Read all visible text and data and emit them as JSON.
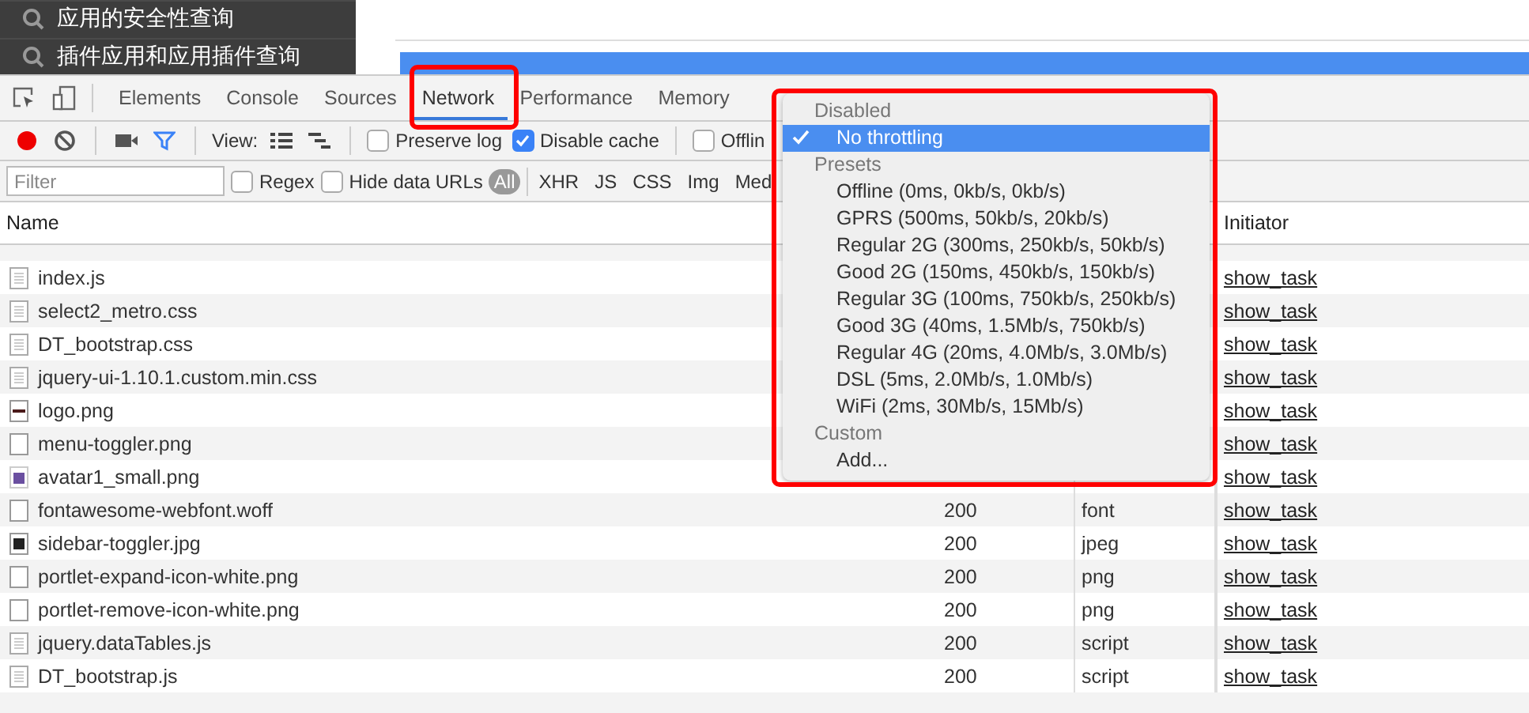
{
  "sidebar": {
    "items": [
      {
        "label": "应用的安全性查询"
      },
      {
        "label": "插件应用和应用插件查询"
      }
    ]
  },
  "devtools": {
    "tabs": [
      {
        "label": "Elements",
        "selected": false
      },
      {
        "label": "Console",
        "selected": false
      },
      {
        "label": "Sources",
        "selected": false
      },
      {
        "label": "Network",
        "selected": true
      },
      {
        "label": "Performance",
        "selected": false
      },
      {
        "label": "Memory",
        "selected": false
      }
    ],
    "toolbar": {
      "recording": true,
      "view_label": "View:",
      "options": [
        {
          "label": "Preserve log",
          "checked": false
        },
        {
          "label": "Disable cache",
          "checked": true
        },
        {
          "label": "Offlin",
          "checked": false
        }
      ]
    },
    "filter": {
      "placeholder": "Filter",
      "options": [
        {
          "label": "Regex",
          "checked": false
        },
        {
          "label": "Hide data URLs",
          "checked": false
        }
      ],
      "types": [
        {
          "label": "All",
          "selected": true
        },
        {
          "label": "XHR",
          "selected": false
        },
        {
          "label": "JS",
          "selected": false
        },
        {
          "label": "CSS",
          "selected": false
        },
        {
          "label": "Img",
          "selected": false
        },
        {
          "label": "Med",
          "selected": false
        }
      ]
    },
    "table": {
      "columns": [
        "Name",
        "Initiator"
      ],
      "rows": [
        {
          "name": "index.js",
          "kind": "doc",
          "initiator": "show_task"
        },
        {
          "name": "select2_metro.css",
          "kind": "doc",
          "initiator": "show_task"
        },
        {
          "name": "DT_bootstrap.css",
          "kind": "doc",
          "initiator": "show_task"
        },
        {
          "name": "jquery-ui-1.10.1.custom.min.css",
          "kind": "doc",
          "initiator": "show_task"
        },
        {
          "name": "logo.png",
          "kind": "logo",
          "initiator": "show_task"
        },
        {
          "name": "menu-toggler.png",
          "kind": "blank",
          "initiator": "show_task"
        },
        {
          "name": "avatar1_small.png",
          "kind": "avatar",
          "initiator": "show_task"
        },
        {
          "name": "fontawesome-webfont.woff",
          "kind": "blank",
          "status": "200",
          "type": "font",
          "initiator": "show_task"
        },
        {
          "name": "sidebar-toggler.jpg",
          "kind": "dark",
          "status": "200",
          "type": "jpeg",
          "initiator": "show_task"
        },
        {
          "name": "portlet-expand-icon-white.png",
          "kind": "blank",
          "status": "200",
          "type": "png",
          "initiator": "show_task"
        },
        {
          "name": "portlet-remove-icon-white.png",
          "kind": "blank",
          "status": "200",
          "type": "png",
          "initiator": "show_task"
        },
        {
          "name": "jquery.dataTables.js",
          "kind": "doc",
          "status": "200",
          "type": "script",
          "initiator": "show_task"
        },
        {
          "name": "DT_bootstrap.js",
          "kind": "doc",
          "status": "200",
          "type": "script",
          "initiator": "show_task"
        }
      ]
    }
  },
  "throttle_menu": {
    "groups": [
      {
        "label": "Disabled",
        "items": [
          {
            "label": "No throttling",
            "selected": true
          }
        ]
      },
      {
        "label": "Presets",
        "items": [
          {
            "label": "Offline (0ms, 0kb/s, 0kb/s)",
            "selected": false
          },
          {
            "label": "GPRS (500ms, 50kb/s, 20kb/s)",
            "selected": false
          },
          {
            "label": "Regular 2G (300ms, 250kb/s, 50kb/s)",
            "selected": false
          },
          {
            "label": "Good 2G (150ms, 450kb/s, 150kb/s)",
            "selected": false
          },
          {
            "label": "Regular 3G (100ms, 750kb/s, 250kb/s)",
            "selected": false
          },
          {
            "label": "Good 3G (40ms, 1.5Mb/s, 750kb/s)",
            "selected": false
          },
          {
            "label": "Regular 4G (20ms, 4.0Mb/s, 3.0Mb/s)",
            "selected": false
          },
          {
            "label": "DSL (5ms, 2.0Mb/s, 1.0Mb/s)",
            "selected": false
          },
          {
            "label": "WiFi (2ms, 30Mb/s, 15Mb/s)",
            "selected": false
          }
        ]
      },
      {
        "label": "Custom",
        "items": [
          {
            "label": "Add...",
            "selected": false
          }
        ]
      }
    ]
  }
}
